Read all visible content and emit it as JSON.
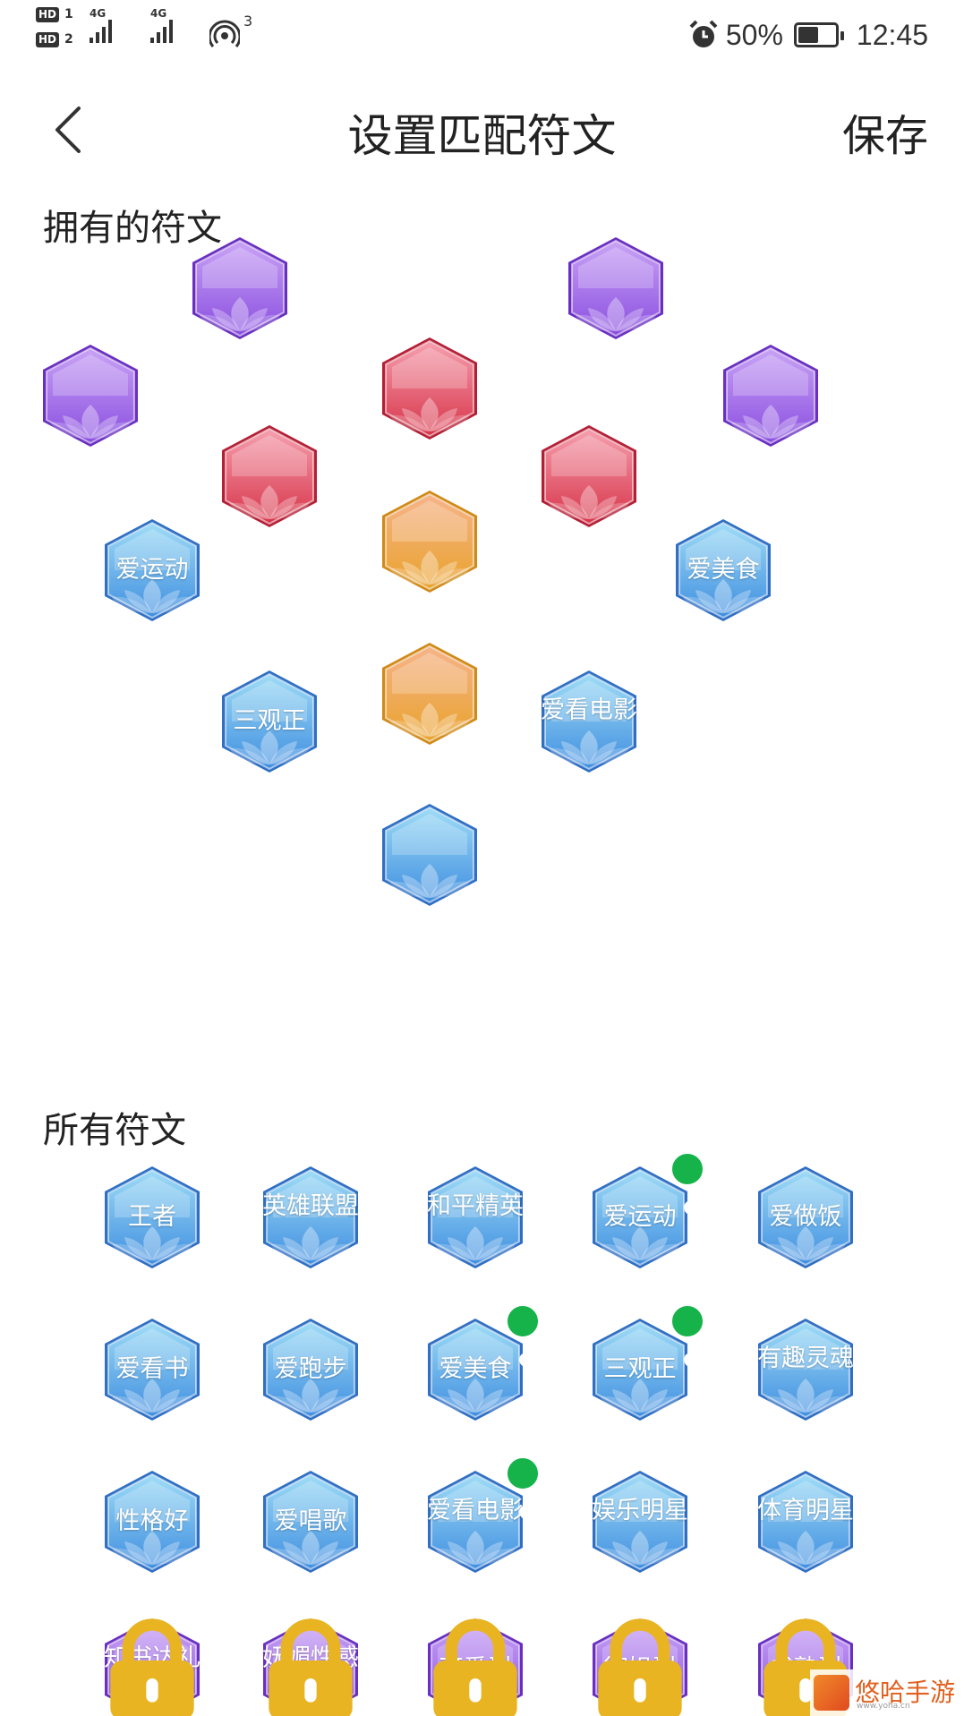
{
  "status_bar": {
    "sim1_label": "HD",
    "sim1_num": "1",
    "sim2_label": "HD",
    "sim2_num": "2",
    "net1": "4G",
    "net2": "4G",
    "hotspot_count": "3",
    "battery": "50%",
    "battery_level": 0.5,
    "time": "12:45"
  },
  "nav": {
    "title": "设置匹配符文",
    "save_label": "保存",
    "back_icon": "chevron-left-icon"
  },
  "owned_section": {
    "title": "拥有的符文",
    "slots": [
      {
        "color": "purple",
        "label": ""
      },
      {
        "color": "purple",
        "label": ""
      },
      {
        "color": "purple",
        "label": ""
      },
      {
        "color": "red",
        "label": ""
      },
      {
        "color": "purple",
        "label": ""
      },
      {
        "color": "red",
        "label": ""
      },
      {
        "color": "red",
        "label": ""
      },
      {
        "color": "blue",
        "label": "爱运动"
      },
      {
        "color": "orange",
        "label": ""
      },
      {
        "color": "blue",
        "label": "爱美食"
      },
      {
        "color": "blue",
        "label": "三观正"
      },
      {
        "color": "orange",
        "label": ""
      },
      {
        "color": "blue",
        "label": "爱看电影"
      },
      {
        "color": "blue",
        "label": ""
      }
    ]
  },
  "all_section": {
    "title": "所有符文",
    "items": [
      {
        "label": "王者",
        "color": "blue",
        "selected": false,
        "locked": false
      },
      {
        "label": "英雄联盟",
        "color": "blue",
        "selected": false,
        "locked": false
      },
      {
        "label": "和平精英",
        "color": "blue",
        "selected": false,
        "locked": false
      },
      {
        "label": "爱运动",
        "color": "blue",
        "selected": true,
        "locked": false
      },
      {
        "label": "爱做饭",
        "color": "blue",
        "selected": false,
        "locked": false
      },
      {
        "label": "爱看书",
        "color": "blue",
        "selected": false,
        "locked": false
      },
      {
        "label": "爱跑步",
        "color": "blue",
        "selected": false,
        "locked": false
      },
      {
        "label": "爱美食",
        "color": "blue",
        "selected": true,
        "locked": false
      },
      {
        "label": "三观正",
        "color": "blue",
        "selected": true,
        "locked": false
      },
      {
        "label": "有趣灵魂",
        "color": "blue",
        "selected": false,
        "locked": false
      },
      {
        "label": "性格好",
        "color": "blue",
        "selected": false,
        "locked": false
      },
      {
        "label": "爱唱歌",
        "color": "blue",
        "selected": false,
        "locked": false
      },
      {
        "label": "爱看电影",
        "color": "blue",
        "selected": true,
        "locked": false
      },
      {
        "label": "娱乐明星",
        "color": "blue",
        "selected": false,
        "locked": false
      },
      {
        "label": "体育明星",
        "color": "blue",
        "selected": false,
        "locked": false
      },
      {
        "label": "知书达礼",
        "color": "purple",
        "selected": false,
        "locked": true
      },
      {
        "label": "妩媚性感",
        "color": "purple",
        "selected": false,
        "locked": true
      },
      {
        "label": "可爱型",
        "color": "purple",
        "selected": false,
        "locked": true
      },
      {
        "label": "御姐型",
        "color": "purple",
        "selected": false,
        "locked": true
      },
      {
        "label": "成熟型",
        "color": "purple",
        "selected": false,
        "locked": true
      }
    ]
  },
  "colors": {
    "blue": [
      "#9fdcf6",
      "#3f8ee0",
      "#2f6fc4"
    ],
    "purple": [
      "#c9a3f5",
      "#8a4ee0",
      "#6a2fc2"
    ],
    "red": [
      "#f5a0ae",
      "#d8344a",
      "#b51f35"
    ],
    "orange": [
      "#f6b48a",
      "#e9a22c",
      "#d18a18"
    ],
    "check": "#16b34a",
    "lock": "#e8b422"
  },
  "watermark": {
    "text": "悠哈手游",
    "sub": "www.yoha.cn"
  }
}
